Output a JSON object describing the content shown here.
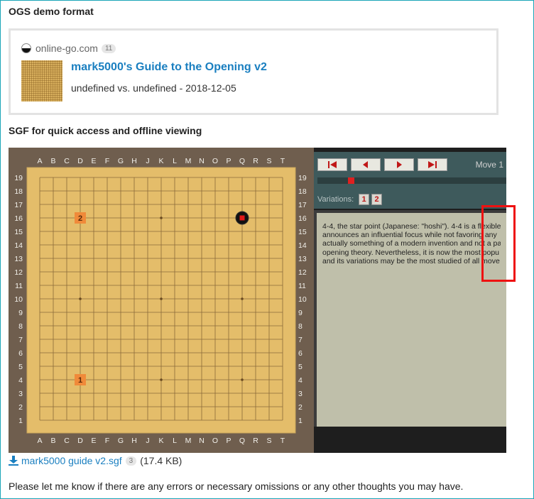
{
  "headings": {
    "ogs": "OGS demo format",
    "sgf": "SGF for quick access and offline viewing"
  },
  "card": {
    "site": "online-go.com",
    "site_count": "11",
    "title": "mark5000's Guide to the Opening v2",
    "subtitle": "undefined vs. undefined - 2018-12-05"
  },
  "board": {
    "columns": [
      "A",
      "B",
      "C",
      "D",
      "E",
      "F",
      "G",
      "H",
      "J",
      "K",
      "L",
      "M",
      "N",
      "O",
      "P",
      "Q",
      "R",
      "S",
      "T"
    ],
    "rows": [
      "19",
      "18",
      "17",
      "16",
      "15",
      "14",
      "13",
      "12",
      "11",
      "10",
      "9",
      "8",
      "7",
      "6",
      "5",
      "4",
      "3",
      "2",
      "1"
    ],
    "marks": [
      {
        "label": "2",
        "col": "D",
        "row": "16"
      },
      {
        "label": "1",
        "col": "D",
        "row": "4"
      }
    ],
    "stones": [
      {
        "color": "black",
        "col": "Q",
        "row": "16",
        "last_move_marker": true
      }
    ],
    "colors": {
      "board": "#e4bd6a",
      "line": "#8a6a3a",
      "label": "#f2f0ea",
      "mark": "#f08a3a",
      "frame": "#6f5e4e"
    }
  },
  "panel": {
    "move_label": "Move 1",
    "variations_label": "Variations:",
    "variations": [
      "1",
      "2"
    ],
    "comment_lines": [
      "4-4, the star point (Japanese: \"hoshi\"). 4-4 is a flexible",
      "announces an influential focus while not favoring any",
      "actually something of a modern invention and not a pa",
      "opening theory. Nevertheless, it is now the most popu",
      "and its variations may be the most studied of all move"
    ],
    "nav_icons": [
      "first-move-icon",
      "prev-move-icon",
      "next-move-icon",
      "last-move-icon"
    ]
  },
  "download": {
    "link": "mark5000 guide v2.sgf",
    "count": "3",
    "size": "(17.4 KB)"
  },
  "footer": "Please let me know if there are any errors or necessary omissions or any other thoughts you may have."
}
